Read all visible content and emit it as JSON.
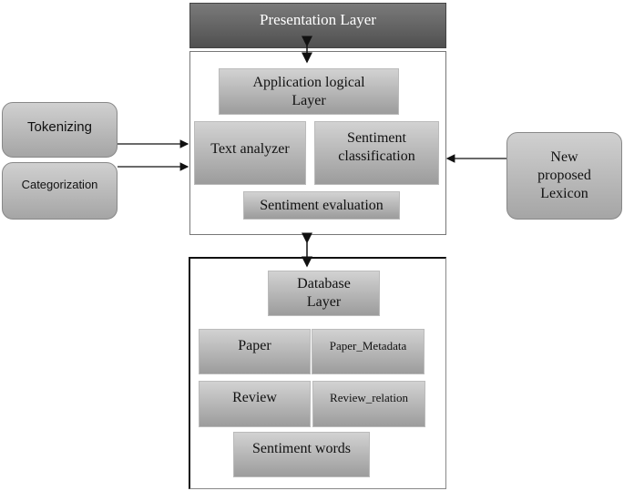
{
  "presentation": "Presentation Layer",
  "application": {
    "title": "Application logical Layer",
    "text_analyzer": "Text analyzer",
    "sentiment_classification": "Sentiment classification",
    "sentiment_evaluation": "Sentiment evaluation"
  },
  "database": {
    "title": "Database Layer",
    "paper": "Paper",
    "paper_metadata": "Paper_Metadata",
    "review": "Review",
    "review_relation": "Review_relation",
    "sentiment_words": "Sentiment words"
  },
  "inputs": {
    "tokenizing": "Tokenizing",
    "categorization": "Categorization",
    "lexicon": "New proposed Lexicon"
  }
}
